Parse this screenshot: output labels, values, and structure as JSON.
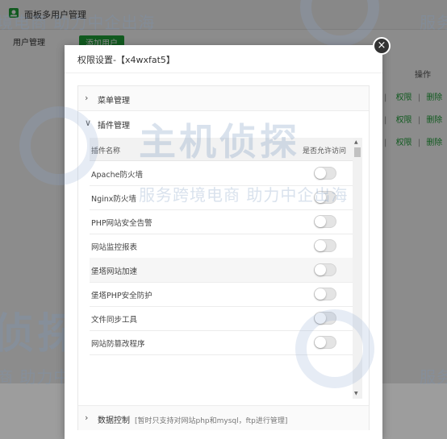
{
  "background_app": {
    "title": "面板多用户管理",
    "tab_label": "用户管理",
    "add_button_label": "添加用户",
    "table_header_operation": "操作",
    "row_actions": {
      "permission": "权限",
      "delete": "删除",
      "separator": "|"
    },
    "row_count": 3
  },
  "watermark": {
    "brand_text": "主机侦探",
    "slogan_text": "服务跨境电商 助力中企出海",
    "fragment_top_left": "境电商 助力中企出海",
    "fragment_bottom_left": "侦探",
    "fragment_bottom_left_small": "商 助力中企出海",
    "fragment_right": "服务"
  },
  "modal": {
    "title": "权限设置-【x4wxfat5】",
    "close_icon": "×",
    "sections": [
      {
        "label": "菜单管理",
        "chevron": "›",
        "expanded": false
      },
      {
        "label": "插件管理",
        "chevron": "∨",
        "expanded": true
      },
      {
        "label": "数据控制",
        "chevron": "›",
        "expanded": false,
        "hint": "[暂时只支持对网站php和mysql，ftp进行管理]"
      }
    ],
    "plugin_table": {
      "col_name": "插件名称",
      "col_access": "是否允许访问",
      "rows": [
        {
          "name": "Apache防火墙",
          "enabled": false
        },
        {
          "name": "Nginx防火墙",
          "enabled": false
        },
        {
          "name": "PHP网站安全告警",
          "enabled": false
        },
        {
          "name": "网站监控报表",
          "enabled": false
        },
        {
          "name": "堡塔网站加速",
          "enabled": false
        },
        {
          "name": "堡塔PHP安全防护",
          "enabled": false
        },
        {
          "name": "文件同步工具",
          "enabled": false
        },
        {
          "name": "网站防篡改程序",
          "enabled": false
        }
      ]
    }
  },
  "colors": {
    "accent": "#20a53a",
    "overlay": "rgba(0,0,0,0.45)"
  }
}
